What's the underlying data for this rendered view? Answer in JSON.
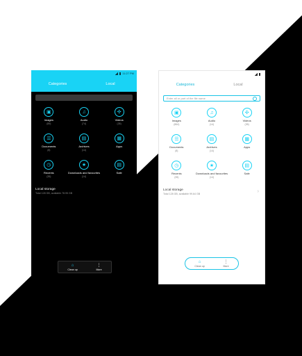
{
  "colors": {
    "accent": "#19d3f5",
    "dark_bg": "#000000",
    "light_bg": "#ffffff"
  },
  "dark": {
    "status": {
      "time": "11:27 PM"
    },
    "tabs": [
      "Categories",
      "Local"
    ],
    "search_placeholder": "",
    "categories": [
      {
        "label": "Images",
        "count": "(89)",
        "icon": "images-icon",
        "glyph": "▣"
      },
      {
        "label": "Audio",
        "count": "(74)",
        "icon": "audio-icon",
        "glyph": "♫"
      },
      {
        "label": "Videos",
        "count": "(35)",
        "icon": "videos-icon",
        "glyph": "✣"
      },
      {
        "label": "Documents",
        "count": "(8)",
        "icon": "documents-icon",
        "glyph": "☰"
      },
      {
        "label": "Archives",
        "count": "(14)",
        "icon": "archives-icon",
        "glyph": "▤"
      },
      {
        "label": "Apps",
        "count": "",
        "icon": "apps-icon",
        "glyph": "▦"
      },
      {
        "label": "Recents",
        "count": "(35)",
        "icon": "recents-icon",
        "glyph": "◷"
      },
      {
        "label": "Downloads and favourites",
        "count": "(14)",
        "icon": "star-icon",
        "glyph": "★"
      },
      {
        "label": "Safe",
        "count": "",
        "icon": "safe-icon",
        "glyph": "▤"
      }
    ],
    "storage": {
      "title": "Local storage",
      "sub": "Total 128 GB, available 78.95 GB"
    },
    "bottom": [
      {
        "label": "Clean up"
      },
      {
        "label": "More"
      }
    ]
  },
  "light": {
    "status": {
      "time": ""
    },
    "tabs": [
      "Categories",
      "Local"
    ],
    "search_placeholder": "Enter all or part of the file name",
    "categories": [
      {
        "label": "Images",
        "count": "(864)",
        "icon": "images-icon",
        "glyph": "▣"
      },
      {
        "label": "Audio",
        "count": "(14)",
        "icon": "audio-icon",
        "glyph": "♫"
      },
      {
        "label": "Videos",
        "count": "(35)",
        "icon": "videos-icon",
        "glyph": "✣"
      },
      {
        "label": "Documents",
        "count": "(8)",
        "icon": "documents-icon",
        "glyph": "☰"
      },
      {
        "label": "Archives",
        "count": "(14)",
        "icon": "archives-icon",
        "glyph": "▤"
      },
      {
        "label": "Apps",
        "count": "",
        "icon": "apps-icon",
        "glyph": "▦"
      },
      {
        "label": "Recents",
        "count": "(35)",
        "icon": "recents-icon",
        "glyph": "◷"
      },
      {
        "label": "Downloads and favourites",
        "count": "(14)",
        "icon": "star-icon",
        "glyph": "★"
      },
      {
        "label": "Safe",
        "count": "",
        "icon": "safe-icon",
        "glyph": "▤"
      }
    ],
    "storage": {
      "title": "Local storage",
      "sub": "Total 128 GB, available 99.64 GB"
    },
    "bottom": [
      {
        "label": "Clean up"
      },
      {
        "label": "More"
      }
    ]
  }
}
